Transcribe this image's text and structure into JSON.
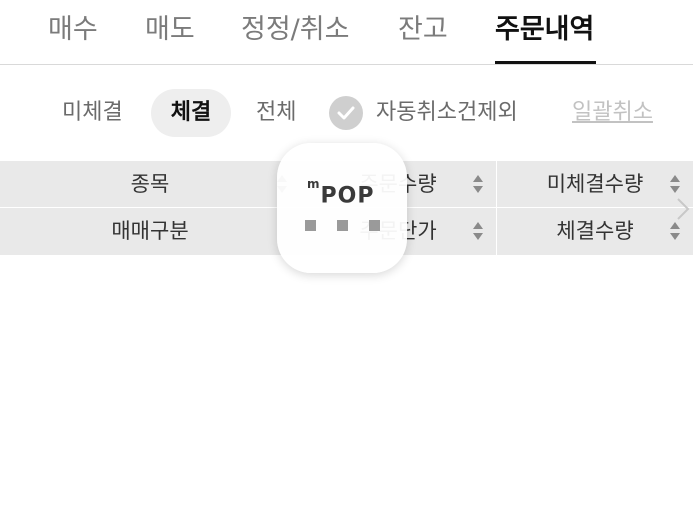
{
  "tabs": [
    {
      "label": "매수",
      "active": false
    },
    {
      "label": "매도",
      "active": false
    },
    {
      "label": "정정/취소",
      "active": false
    },
    {
      "label": "잔고",
      "active": false
    },
    {
      "label": "주문내역",
      "active": true
    }
  ],
  "filter": {
    "segments": [
      {
        "label": "미체결",
        "selected": false
      },
      {
        "label": "체결",
        "selected": true
      },
      {
        "label": "전체",
        "selected": false
      }
    ],
    "exclude_auto_cancel": {
      "label": "자동취소건제외",
      "checked": true
    },
    "cancel_all_label": "일괄취소"
  },
  "table_header": {
    "row1": [
      "종목",
      "주문수량",
      "미체결수량"
    ],
    "row2": [
      "매매구분",
      "주문단가",
      "체결수량"
    ]
  },
  "loading": {
    "logo_prefix": "m",
    "logo_text": "POP"
  },
  "colors": {
    "active_tab": "#111111",
    "inactive_tab": "#7b7b7b",
    "header_bg": "#e9e9e9",
    "pill_bg": "#eeeeee",
    "disabled_link": "#c2c2c2"
  }
}
